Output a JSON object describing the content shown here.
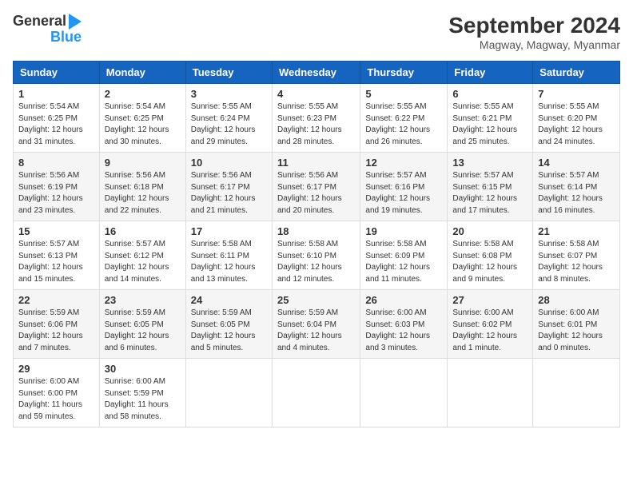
{
  "logo": {
    "line1": "General",
    "line2": "Blue"
  },
  "title": "September 2024",
  "subtitle": "Magway, Magway, Myanmar",
  "weekdays": [
    "Sunday",
    "Monday",
    "Tuesday",
    "Wednesday",
    "Thursday",
    "Friday",
    "Saturday"
  ],
  "weeks": [
    [
      {
        "day": "1",
        "sunrise": "5:54 AM",
        "sunset": "6:25 PM",
        "daylight": "12 hours and 31 minutes."
      },
      {
        "day": "2",
        "sunrise": "5:54 AM",
        "sunset": "6:25 PM",
        "daylight": "12 hours and 30 minutes."
      },
      {
        "day": "3",
        "sunrise": "5:55 AM",
        "sunset": "6:24 PM",
        "daylight": "12 hours and 29 minutes."
      },
      {
        "day": "4",
        "sunrise": "5:55 AM",
        "sunset": "6:23 PM",
        "daylight": "12 hours and 28 minutes."
      },
      {
        "day": "5",
        "sunrise": "5:55 AM",
        "sunset": "6:22 PM",
        "daylight": "12 hours and 26 minutes."
      },
      {
        "day": "6",
        "sunrise": "5:55 AM",
        "sunset": "6:21 PM",
        "daylight": "12 hours and 25 minutes."
      },
      {
        "day": "7",
        "sunrise": "5:55 AM",
        "sunset": "6:20 PM",
        "daylight": "12 hours and 24 minutes."
      }
    ],
    [
      {
        "day": "8",
        "sunrise": "5:56 AM",
        "sunset": "6:19 PM",
        "daylight": "12 hours and 23 minutes."
      },
      {
        "day": "9",
        "sunrise": "5:56 AM",
        "sunset": "6:18 PM",
        "daylight": "12 hours and 22 minutes."
      },
      {
        "day": "10",
        "sunrise": "5:56 AM",
        "sunset": "6:17 PM",
        "daylight": "12 hours and 21 minutes."
      },
      {
        "day": "11",
        "sunrise": "5:56 AM",
        "sunset": "6:17 PM",
        "daylight": "12 hours and 20 minutes."
      },
      {
        "day": "12",
        "sunrise": "5:57 AM",
        "sunset": "6:16 PM",
        "daylight": "12 hours and 19 minutes."
      },
      {
        "day": "13",
        "sunrise": "5:57 AM",
        "sunset": "6:15 PM",
        "daylight": "12 hours and 17 minutes."
      },
      {
        "day": "14",
        "sunrise": "5:57 AM",
        "sunset": "6:14 PM",
        "daylight": "12 hours and 16 minutes."
      }
    ],
    [
      {
        "day": "15",
        "sunrise": "5:57 AM",
        "sunset": "6:13 PM",
        "daylight": "12 hours and 15 minutes."
      },
      {
        "day": "16",
        "sunrise": "5:57 AM",
        "sunset": "6:12 PM",
        "daylight": "12 hours and 14 minutes."
      },
      {
        "day": "17",
        "sunrise": "5:58 AM",
        "sunset": "6:11 PM",
        "daylight": "12 hours and 13 minutes."
      },
      {
        "day": "18",
        "sunrise": "5:58 AM",
        "sunset": "6:10 PM",
        "daylight": "12 hours and 12 minutes."
      },
      {
        "day": "19",
        "sunrise": "5:58 AM",
        "sunset": "6:09 PM",
        "daylight": "12 hours and 11 minutes."
      },
      {
        "day": "20",
        "sunrise": "5:58 AM",
        "sunset": "6:08 PM",
        "daylight": "12 hours and 9 minutes."
      },
      {
        "day": "21",
        "sunrise": "5:58 AM",
        "sunset": "6:07 PM",
        "daylight": "12 hours and 8 minutes."
      }
    ],
    [
      {
        "day": "22",
        "sunrise": "5:59 AM",
        "sunset": "6:06 PM",
        "daylight": "12 hours and 7 minutes."
      },
      {
        "day": "23",
        "sunrise": "5:59 AM",
        "sunset": "6:05 PM",
        "daylight": "12 hours and 6 minutes."
      },
      {
        "day": "24",
        "sunrise": "5:59 AM",
        "sunset": "6:05 PM",
        "daylight": "12 hours and 5 minutes."
      },
      {
        "day": "25",
        "sunrise": "5:59 AM",
        "sunset": "6:04 PM",
        "daylight": "12 hours and 4 minutes."
      },
      {
        "day": "26",
        "sunrise": "6:00 AM",
        "sunset": "6:03 PM",
        "daylight": "12 hours and 3 minutes."
      },
      {
        "day": "27",
        "sunrise": "6:00 AM",
        "sunset": "6:02 PM",
        "daylight": "12 hours and 1 minute."
      },
      {
        "day": "28",
        "sunrise": "6:00 AM",
        "sunset": "6:01 PM",
        "daylight": "12 hours and 0 minutes."
      }
    ],
    [
      {
        "day": "29",
        "sunrise": "6:00 AM",
        "sunset": "6:00 PM",
        "daylight": "11 hours and 59 minutes."
      },
      {
        "day": "30",
        "sunrise": "6:00 AM",
        "sunset": "5:59 PM",
        "daylight": "11 hours and 58 minutes."
      },
      null,
      null,
      null,
      null,
      null
    ]
  ]
}
